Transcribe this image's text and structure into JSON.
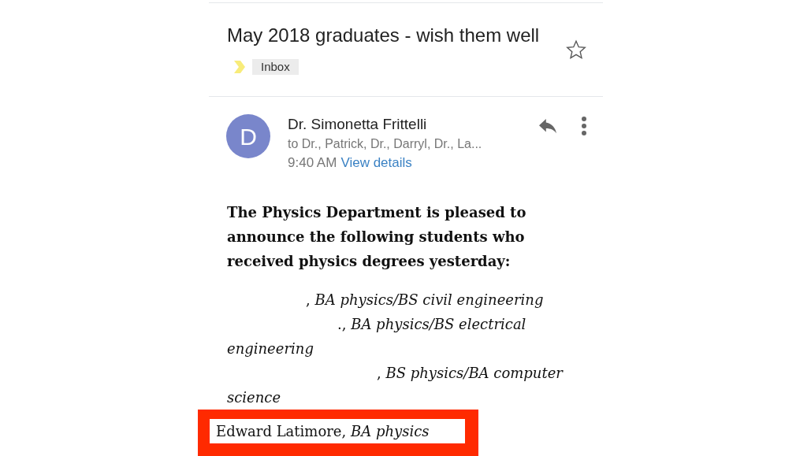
{
  "subject": {
    "title": "May 2018 graduates - wish them well",
    "label": "Inbox",
    "starred": false
  },
  "message": {
    "avatar_letter": "D",
    "sender": "Dr. Simonetta Frittelli",
    "recipients": "to Dr., Patrick, Dr., Darryl, Dr., La...",
    "time": "9:40 AM",
    "details_link": "View details"
  },
  "body": {
    "intro": "The Physics Department is pleased to announce the following students who received physics degrees yesterday:",
    "entries": [
      {
        "text": ", *BA physics/BS civil engineering*",
        "highlighted": false
      },
      {
        "text": "., *BA physics/BS electrical engineering*",
        "highlighted": false
      },
      {
        "text": ", *BS physics/BA computer science*",
        "highlighted": false
      },
      {
        "text": "Edward Latimore, *BA physics*",
        "highlighted": true
      }
    ]
  }
}
